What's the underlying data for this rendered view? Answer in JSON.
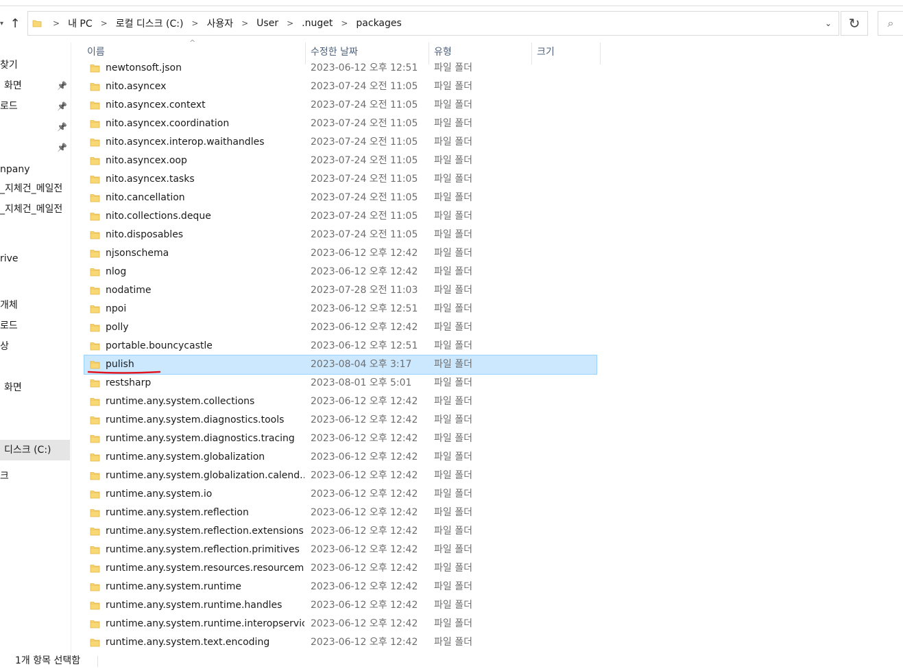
{
  "nav": {
    "up_icon": "up-arrow-icon",
    "recent_icon": "chevron-down-icon"
  },
  "address": {
    "crumbs": [
      "내 PC",
      "로컬 디스크 (C:)",
      "사용자",
      "User",
      ".nuget",
      "packages"
    ],
    "separator": ">"
  },
  "toolbar": {
    "refresh_icon": "refresh-icon",
    "search_icon": "search-icon"
  },
  "sidebar": {
    "items": [
      {
        "label": "찾기",
        "pinned": false
      },
      {
        "label": "화면",
        "pinned": true
      },
      {
        "label": "로드",
        "pinned": true
      },
      {
        "label": "",
        "pinned": true
      },
      {
        "label": "",
        "pinned": true
      },
      {
        "label": "npany",
        "pinned": false
      },
      {
        "label": "_지체건_메일전",
        "pinned": false
      },
      {
        "label": "_지체건_메일전",
        "pinned": false
      },
      {
        "label": "rive",
        "pinned": false
      },
      {
        "label": "개체",
        "pinned": false
      },
      {
        "label": "로드",
        "pinned": false
      },
      {
        "label": "상",
        "pinned": false
      },
      {
        "label": "화면",
        "pinned": false
      },
      {
        "label": "디스크 (C:)",
        "pinned": false,
        "selected": true
      },
      {
        "label": "크",
        "pinned": false
      }
    ]
  },
  "columns": {
    "name": "이름",
    "date": "수정한 날짜",
    "type": "유형",
    "size": "크기"
  },
  "files": [
    {
      "name": "newtonsoft.json",
      "date": "2023-06-12 오후 12:51",
      "type": "파일 폴더"
    },
    {
      "name": "nito.asyncex",
      "date": "2023-07-24 오전 11:05",
      "type": "파일 폴더"
    },
    {
      "name": "nito.asyncex.context",
      "date": "2023-07-24 오전 11:05",
      "type": "파일 폴더"
    },
    {
      "name": "nito.asyncex.coordination",
      "date": "2023-07-24 오전 11:05",
      "type": "파일 폴더"
    },
    {
      "name": "nito.asyncex.interop.waithandles",
      "date": "2023-07-24 오전 11:05",
      "type": "파일 폴더"
    },
    {
      "name": "nito.asyncex.oop",
      "date": "2023-07-24 오전 11:05",
      "type": "파일 폴더"
    },
    {
      "name": "nito.asyncex.tasks",
      "date": "2023-07-24 오전 11:05",
      "type": "파일 폴더"
    },
    {
      "name": "nito.cancellation",
      "date": "2023-07-24 오전 11:05",
      "type": "파일 폴더"
    },
    {
      "name": "nito.collections.deque",
      "date": "2023-07-24 오전 11:05",
      "type": "파일 폴더"
    },
    {
      "name": "nito.disposables",
      "date": "2023-07-24 오전 11:05",
      "type": "파일 폴더"
    },
    {
      "name": "njsonschema",
      "date": "2023-06-12 오후 12:42",
      "type": "파일 폴더"
    },
    {
      "name": "nlog",
      "date": "2023-06-12 오후 12:42",
      "type": "파일 폴더"
    },
    {
      "name": "nodatime",
      "date": "2023-07-28 오전 11:03",
      "type": "파일 폴더"
    },
    {
      "name": "npoi",
      "date": "2023-06-12 오후 12:51",
      "type": "파일 폴더"
    },
    {
      "name": "polly",
      "date": "2023-06-12 오후 12:42",
      "type": "파일 폴더"
    },
    {
      "name": "portable.bouncycastle",
      "date": "2023-06-12 오후 12:51",
      "type": "파일 폴더"
    },
    {
      "name": "pulish",
      "date": "2023-08-04 오후 3:17",
      "type": "파일 폴더",
      "selected": true
    },
    {
      "name": "restsharp",
      "date": "2023-08-01 오후 5:01",
      "type": "파일 폴더"
    },
    {
      "name": "runtime.any.system.collections",
      "date": "2023-06-12 오후 12:42",
      "type": "파일 폴더"
    },
    {
      "name": "runtime.any.system.diagnostics.tools",
      "date": "2023-06-12 오후 12:42",
      "type": "파일 폴더"
    },
    {
      "name": "runtime.any.system.diagnostics.tracing",
      "date": "2023-06-12 오후 12:42",
      "type": "파일 폴더"
    },
    {
      "name": "runtime.any.system.globalization",
      "date": "2023-06-12 오후 12:42",
      "type": "파일 폴더"
    },
    {
      "name": "runtime.any.system.globalization.calend...",
      "date": "2023-06-12 오후 12:42",
      "type": "파일 폴더"
    },
    {
      "name": "runtime.any.system.io",
      "date": "2023-06-12 오후 12:42",
      "type": "파일 폴더"
    },
    {
      "name": "runtime.any.system.reflection",
      "date": "2023-06-12 오후 12:42",
      "type": "파일 폴더"
    },
    {
      "name": "runtime.any.system.reflection.extensions",
      "date": "2023-06-12 오후 12:42",
      "type": "파일 폴더"
    },
    {
      "name": "runtime.any.system.reflection.primitives",
      "date": "2023-06-12 오후 12:42",
      "type": "파일 폴더"
    },
    {
      "name": "runtime.any.system.resources.resourcem...",
      "date": "2023-06-12 오후 12:42",
      "type": "파일 폴더"
    },
    {
      "name": "runtime.any.system.runtime",
      "date": "2023-06-12 오후 12:42",
      "type": "파일 폴더"
    },
    {
      "name": "runtime.any.system.runtime.handles",
      "date": "2023-06-12 오후 12:42",
      "type": "파일 폴더"
    },
    {
      "name": "runtime.any.system.runtime.interopservic...",
      "date": "2023-06-12 오후 12:42",
      "type": "파일 폴더"
    },
    {
      "name": "runtime.any.system.text.encoding",
      "date": "2023-06-12 오후 12:42",
      "type": "파일 폴더"
    }
  ],
  "status": {
    "selection": "1개 항목 선택함"
  },
  "colors": {
    "selected_bg": "#cce8ff",
    "selected_border": "#99d1ff",
    "folder": "#f8d775",
    "annotation": "#e0141e"
  }
}
